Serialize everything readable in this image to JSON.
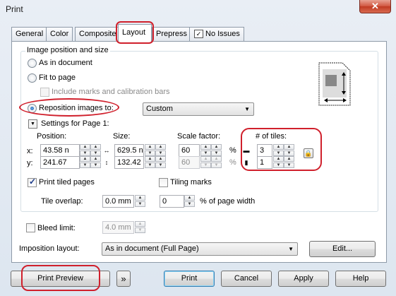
{
  "window": {
    "title": "Print",
    "close": "✕"
  },
  "tabs": [
    "General",
    "Color",
    "Composite",
    "Layout",
    "Prepress",
    "No Issues"
  ],
  "image_position": {
    "group_label": "Image position and size",
    "as_in_document": "As in document",
    "fit_to_page": "Fit to page",
    "include_marks": "Include marks and calibration bars",
    "reposition": "Reposition images to:",
    "reposition_value": "Custom"
  },
  "settings": {
    "label": "Settings for Page 1:",
    "position_label": "Position:",
    "size_label": "Size:",
    "scale_label": "Scale factor:",
    "tiles_label": "# of tiles:",
    "x_label": "x:",
    "y_label": "y:",
    "x": "43.58 n",
    "y": "241.67",
    "width": "629.5 n",
    "height": "132.42",
    "scale_x": "60",
    "scale_y": "60",
    "percent": "%",
    "tiles_x": "3",
    "tiles_y": "1"
  },
  "tiling": {
    "print_tiled": "Print tiled pages",
    "tiling_marks": "Tiling marks",
    "tile_overlap_label": "Tile overlap:",
    "tile_overlap": "0.0 mm",
    "overlap_percent": "0",
    "percent_of_page": "% of page width"
  },
  "bleed": {
    "label": "Bleed limit:",
    "value": "4.0 mm"
  },
  "imposition": {
    "label": "Imposition layout:",
    "value": "As in document (Full Page)",
    "edit": "Edit..."
  },
  "footer": {
    "print_preview": "Print Preview",
    "expand": "»",
    "print": "Print",
    "cancel": "Cancel",
    "apply": "Apply",
    "help": "Help"
  },
  "checks": {
    "print_tiled": true,
    "tiling_marks": false,
    "bleed": false,
    "include_marks": false
  }
}
